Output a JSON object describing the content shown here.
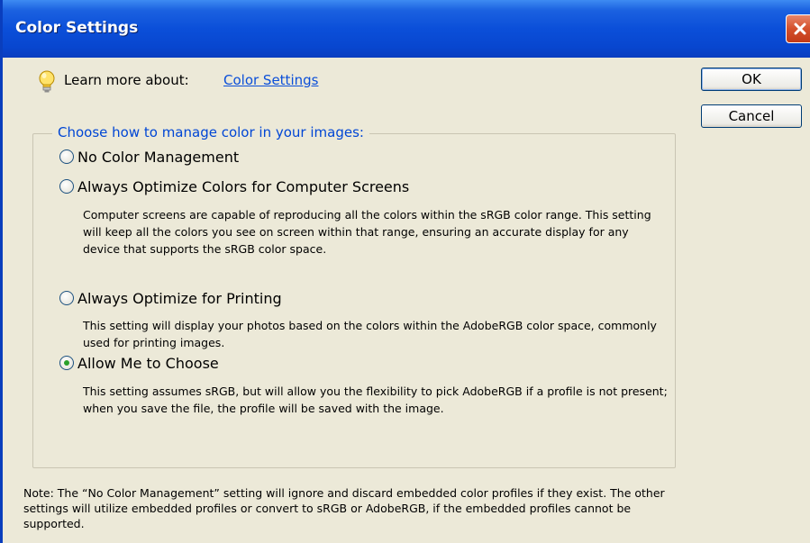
{
  "window": {
    "title": "Color Settings"
  },
  "learn": {
    "prefix": "Learn more about:",
    "link": "Color Settings"
  },
  "buttons": {
    "ok": "OK",
    "cancel": "Cancel"
  },
  "group": {
    "legend": "Choose how to manage color in your images:",
    "options": [
      {
        "label": "No Color Management",
        "description": "",
        "selected": false
      },
      {
        "label": "Always Optimize Colors for Computer Screens",
        "description": "Computer screens are capable of reproducing all the colors within the sRGB color range. This setting will keep all the colors you see on screen within that range, ensuring an accurate display for any device that supports the sRGB color space.",
        "selected": false
      },
      {
        "label": "Always Optimize for Printing",
        "description": "This setting will display your photos based on the colors within the AdobeRGB color space, commonly used for printing images.",
        "selected": false
      },
      {
        "label": "Allow Me to Choose",
        "description": "This setting assumes sRGB, but will allow you the flexibility to pick AdobeRGB if a profile is not present; when you save the file, the profile will be saved with the image.",
        "selected": true
      }
    ]
  },
  "note": "Note: The “No Color Management” setting will ignore and discard embedded color profiles if they exist. The other settings will utilize embedded profiles or convert to sRGB or AdobeRGB, if the embedded profiles cannot be supported.",
  "colors": {
    "title_bar": "#0b4fd9",
    "link": "#0b4fd9",
    "legend": "#0046d5",
    "dialog_bg": "#ece9d8"
  },
  "icons": {
    "tip": "lightbulb-icon",
    "close": "close-icon"
  }
}
